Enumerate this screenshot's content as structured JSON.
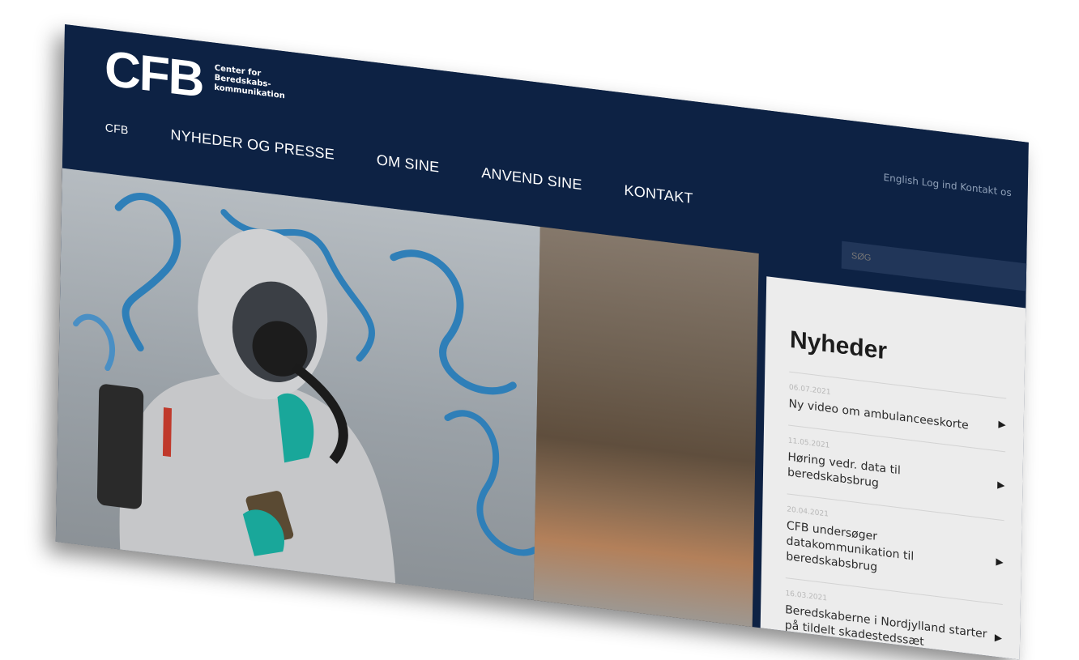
{
  "logo": {
    "mark": "CFB",
    "sub": "Center for Beredskabs-kommunikation"
  },
  "toplinks": "English   Log ind   Kontakt os",
  "nav": {
    "items": [
      "CFB",
      "NYHEDER OG PRESSE",
      "OM SINE",
      "ANVEND SINE",
      "KONTAKT"
    ]
  },
  "search": {
    "placeholder": "SØG",
    "icon": "search-icon"
  },
  "news": {
    "title": "Nyheder",
    "items": [
      {
        "date": "06.07.2021",
        "headline": "Ny video om ambulanceeskorte"
      },
      {
        "date": "11.05.2021",
        "headline": "Høring vedr. data til beredskabsbrug"
      },
      {
        "date": "20.04.2021",
        "headline": "CFB undersøger datakommunikation til beredskabsbrug"
      },
      {
        "date": "16.03.2021",
        "headline": "Beredskaberne i Nordjylland starter på tildelt skadestedssæt"
      }
    ]
  },
  "colors": {
    "header_bg": "#0d2244",
    "panel_bg": "#ececec",
    "accent_glove": "#19a79a"
  }
}
